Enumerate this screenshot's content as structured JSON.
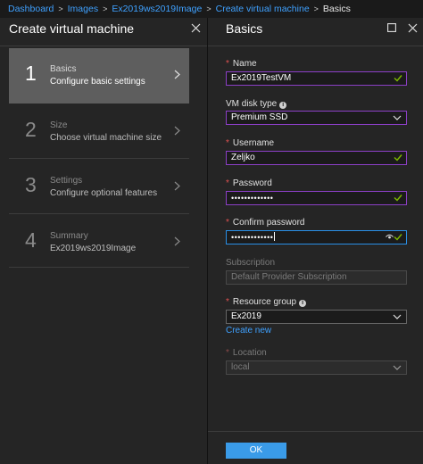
{
  "breadcrumb": {
    "items": [
      "Dashboard",
      "Images",
      "Ex2019ws2019Image",
      "Create virtual machine"
    ],
    "current": "Basics",
    "separator": ">"
  },
  "left_blade": {
    "title": "Create virtual machine",
    "steps": [
      {
        "number": "1",
        "title": "Basics",
        "subtitle": "Configure basic settings",
        "active": true
      },
      {
        "number": "2",
        "title": "Size",
        "subtitle": "Choose virtual machine size",
        "active": false
      },
      {
        "number": "3",
        "title": "Settings",
        "subtitle": "Configure optional features",
        "active": false
      },
      {
        "number": "4",
        "title": "Summary",
        "subtitle": "Ex2019ws2019Image",
        "active": false
      }
    ]
  },
  "right_blade": {
    "title": "Basics",
    "fields": {
      "name": {
        "label": "Name",
        "value": "Ex2019TestVM"
      },
      "vm_disk_type": {
        "label": "VM disk type",
        "value": "Premium SSD"
      },
      "username": {
        "label": "Username",
        "value": "Zeljko"
      },
      "password": {
        "label": "Password",
        "value": "•••••••••••••"
      },
      "confirm_password": {
        "label": "Confirm password",
        "value": "•••••••••••••"
      },
      "subscription": {
        "label": "Subscription",
        "value": "Default Provider Subscription"
      },
      "resource_group": {
        "label": "Resource group",
        "value": "Ex2019"
      },
      "location": {
        "label": "Location",
        "value": "local"
      }
    },
    "create_new_link": "Create new",
    "ok_label": "OK"
  },
  "colors": {
    "accent_blue": "#3fa1ff",
    "required_red": "#e05252",
    "valid_green": "#7fba00",
    "purple_border": "#8c3fc7",
    "focus_border": "#2a8fe6"
  },
  "icons": [
    "close-icon",
    "maximize-icon",
    "chevron-right-icon",
    "check-icon",
    "chevron-down-icon",
    "info-icon",
    "eye-icon"
  ]
}
